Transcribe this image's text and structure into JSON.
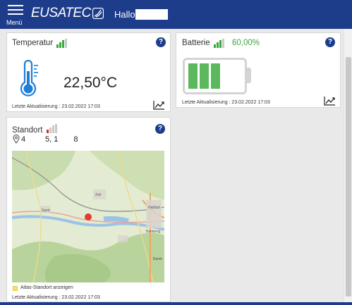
{
  "header": {
    "menu_label": "Menü",
    "logo_text": "EUSATEC",
    "greeting": "Hallo"
  },
  "temperature": {
    "title": "Temperatur",
    "value": "22,50°C",
    "updated": "Letzte Aktualisierung : 23.02.2022 17:03",
    "signal_level": 3
  },
  "battery": {
    "title": "Batterie",
    "percent_text": "60,00%",
    "level_fraction": 0.6,
    "updated": "Letzte Aktualisierung : 23.02.2022 17:03",
    "signal_level": 3
  },
  "location": {
    "title": "Standort",
    "coord_lat": "4",
    "coord_lon": "5, 1  8",
    "signal_level": 1,
    "atlas_checkbox_label": "Atlas-Standort anzeigen",
    "updated": "Letzte Aktualisierung : 23.02.2022 17:03",
    "map_labels": [
      "Haßfurt",
      "Sand",
      "Zeil",
      "Bamberg",
      "Bamb"
    ]
  },
  "colors": {
    "brand": "#1d3d8b",
    "signal_green": "#3aa83a",
    "battery_green": "#5cb85c",
    "map_marker": "#e53935"
  },
  "icons": {
    "menu": "hamburger-icon",
    "help": "question-icon",
    "thermometer": "thermometer-icon",
    "battery": "battery-icon",
    "trend": "trend-chart-icon",
    "location": "location-pin-icon"
  }
}
